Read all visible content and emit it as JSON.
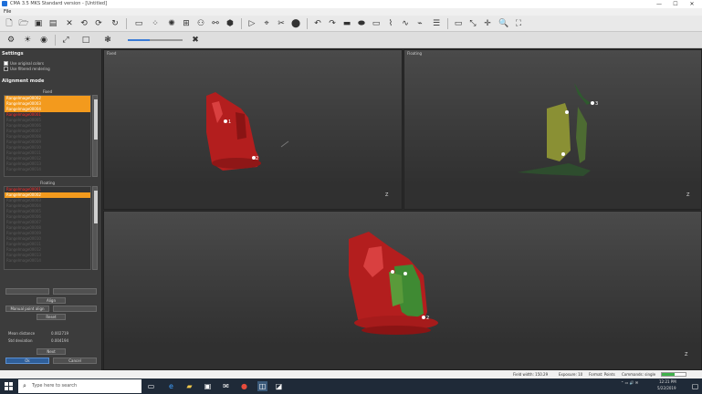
{
  "window": {
    "title": "CMA 3.5 MKS Standard version - [Untitled]",
    "minimize": "—",
    "maximize": "☐",
    "close": "✕"
  },
  "menu": {
    "file": "File"
  },
  "settings": {
    "title": "Settings",
    "options": [
      {
        "label": "Use original colors",
        "checked": false
      },
      {
        "label": "Use filtered rendering",
        "checked": true
      }
    ]
  },
  "alignment": {
    "title": "Alignment mode",
    "fixed_header": "Fixed",
    "fixed_items": [
      "RangeImage00002",
      "RangeImage00003",
      "RangeImage00004",
      "RangeImage00001"
    ],
    "floating_header": "Floating",
    "floating_items": [
      "RangeImage00001",
      "RangeImage00002"
    ],
    "buttons": {
      "align": "Align",
      "manual": "Manual point align",
      "reset": "Reset",
      "next": "Next",
      "ok": "Ok",
      "cancel": "Cancel"
    },
    "mean_distance_label": "Mean distance",
    "mean_distance_value": "0.002719",
    "std_deviation_label": "Std deviation",
    "std_deviation_value": "0.004194"
  },
  "viewports": {
    "fixed_label": "Fixed",
    "floating_label": "Floating",
    "markers": {
      "m1": "1",
      "m2": "2",
      "m3": "3"
    },
    "axis": "Z"
  },
  "status": {
    "field_width": "Field width: 150.29",
    "exposure": "Exposure: 10",
    "format": "Format: Points",
    "mode": "Commands: single",
    "progress": 0.55
  },
  "taskbar": {
    "search_placeholder": "Type here to search",
    "tray_time": "12:21 PM",
    "tray_date": "5/22/2019"
  }
}
